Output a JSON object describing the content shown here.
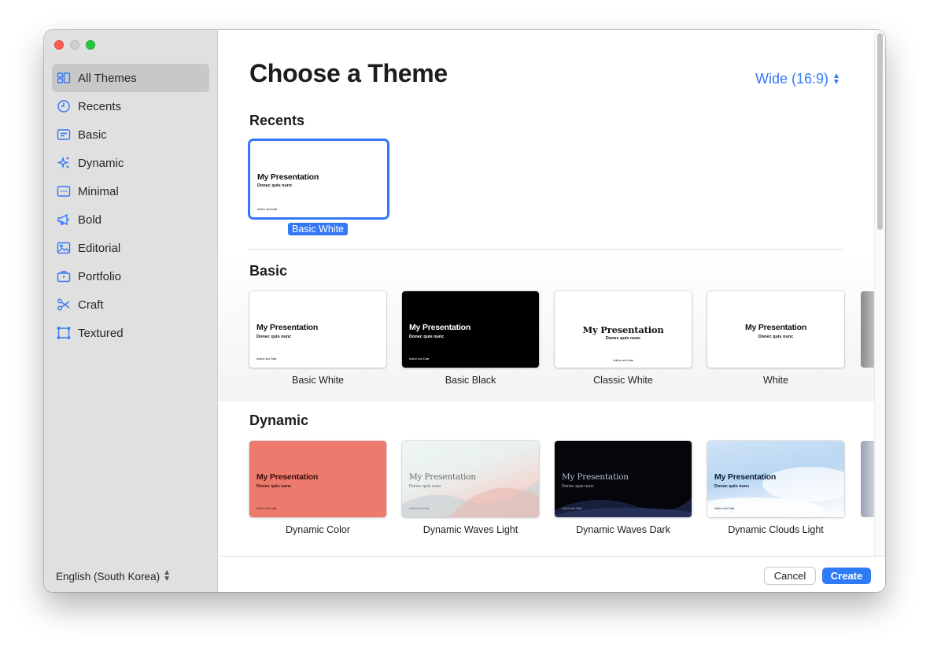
{
  "window": {
    "sidebar": {
      "items": [
        {
          "label": "All Themes",
          "icon": "all-themes-icon",
          "active": true
        },
        {
          "label": "Recents",
          "icon": "clock-icon"
        },
        {
          "label": "Basic",
          "icon": "basic-slide-icon"
        },
        {
          "label": "Dynamic",
          "icon": "sparkles-icon"
        },
        {
          "label": "Minimal",
          "icon": "minimal-slide-icon"
        },
        {
          "label": "Bold",
          "icon": "megaphone-icon"
        },
        {
          "label": "Editorial",
          "icon": "image-frame-icon"
        },
        {
          "label": "Portfolio",
          "icon": "briefcase-icon"
        },
        {
          "label": "Craft",
          "icon": "scissors-icon"
        },
        {
          "label": "Textured",
          "icon": "textured-frame-icon"
        }
      ],
      "language": "English (South Korea)"
    },
    "main": {
      "title": "Choose a Theme",
      "aspect_ratio": "Wide (16:9)",
      "recents": {
        "heading": "Recents",
        "items": [
          {
            "name": "Basic White",
            "slide_title": "My Presentation",
            "slide_subtitle": "Donec quis nunc",
            "slide_footer": "Author and Date",
            "selected": true
          }
        ]
      },
      "basic": {
        "heading": "Basic",
        "items": [
          {
            "name": "Basic White",
            "slide_title": "My Presentation",
            "slide_subtitle": "Donec quis nunc",
            "slide_footer": "Author and Date"
          },
          {
            "name": "Basic Black",
            "slide_title": "My Presentation",
            "slide_subtitle": "Donec quis nunc",
            "slide_footer": "Author and Date"
          },
          {
            "name": "Classic White",
            "slide_title": "My Presentation",
            "slide_subtitle": "Donec quis nunc",
            "slide_footer": "Author and Date"
          },
          {
            "name": "White",
            "slide_title": "My Presentation",
            "slide_subtitle": "Donec quis nunc"
          }
        ]
      },
      "dynamic": {
        "heading": "Dynamic",
        "items": [
          {
            "name": "Dynamic Color",
            "slide_title": "My Presentation",
            "slide_subtitle": "Donec quis nunc",
            "slide_footer": "Author and Date"
          },
          {
            "name": "Dynamic Waves Light",
            "slide_title": "My Presentation",
            "slide_subtitle": "Donec quis nunc",
            "slide_footer": "Author and Date"
          },
          {
            "name": "Dynamic Waves Dark",
            "slide_title": "My Presentation",
            "slide_subtitle": "Donec quis nunc",
            "slide_footer": "Author and Date"
          },
          {
            "name": "Dynamic Clouds Light",
            "slide_title": "My Presentation",
            "slide_subtitle": "Donec quis nunc",
            "slide_footer": "Author and Date"
          }
        ]
      }
    },
    "footer": {
      "cancel_label": "Cancel",
      "create_label": "Create"
    }
  },
  "colors": {
    "accent": "#3478f6",
    "sidebar_bg": "#e0e0e0",
    "dynamic_color_bg": "#ec7b6e"
  }
}
